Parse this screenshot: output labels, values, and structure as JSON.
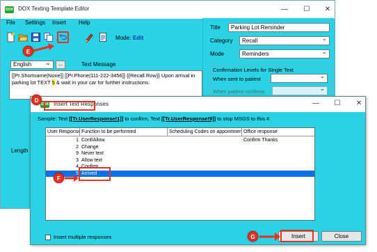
{
  "editor": {
    "title": "DOX Texting Template Editor",
    "logo": "DOX",
    "window_controls": [
      "—",
      "☐",
      "✕"
    ],
    "menu": [
      "File",
      "Settings",
      "Insert",
      "Help"
    ],
    "toolbar_icons": [
      "new-doc-icon",
      "open-folder-icon",
      "save-icon",
      "copy-icon",
      "undo-icon",
      "spellcheck-icon",
      "preview-icon"
    ],
    "mode_label": "Mode:",
    "mode_value": "Edit",
    "language": "English",
    "lang_button": "...",
    "text_message_label": "Text Message",
    "message_parts": [
      "[[Pr.Shortname|None]] [[Pr.Phone|111-222-3456]]  {{Recall Row}}  Upon arrival in parking lot TEXT ",
      "5",
      " & wait in your car for further instructions."
    ],
    "length_label": "Length is"
  },
  "right_panel": {
    "title_label": "Title",
    "title_value": "Parking Lot Reminder",
    "category_label": "Category",
    "category_value": "Recall",
    "mode_label": "Mode",
    "mode_value": "Reminders",
    "confirm_heading": "Confirmation Levels for Single Text",
    "sent_label": "When sent to patient",
    "confirms_label": "When patient confirms"
  },
  "dialog": {
    "title": "Insert Text Responses",
    "logo": "DOX",
    "window_controls": [
      "—",
      "☐",
      "✕"
    ],
    "sample_prefix": "Sample:  Text  ",
    "sample_token1": "[[Tr.UserResponse!1]]",
    "sample_mid": "  to confirm, Text  ",
    "sample_token2": "[[Tr.UserResponse!9]]",
    "sample_suffix": "  to stop MSGS to this #.",
    "columns": [
      "User Response",
      "Function to be performed",
      "Scheduling Codes on appointment",
      "Office response"
    ],
    "rows": [
      {
        "response": "1",
        "function": "Conf/Allow",
        "codes": "",
        "office": "Confirm Thanks"
      },
      {
        "response": "2",
        "function": "Change",
        "codes": "",
        "office": ""
      },
      {
        "response": "9",
        "function": "Never text",
        "codes": "",
        "office": ""
      },
      {
        "response": "3",
        "function": "Allow text",
        "codes": "",
        "office": ""
      },
      {
        "response": "4",
        "function": "Confirm",
        "codes": "",
        "office": ""
      },
      {
        "response": "5",
        "function": "Arrived",
        "codes": "",
        "office": ""
      }
    ],
    "selected_row": 5,
    "multi_label": "Insert multiple responses",
    "insert_label": "Insert",
    "close_label": "Close"
  },
  "annotations": [
    "E",
    "D",
    "F",
    "G"
  ],
  "colors": {
    "panel": "#29d2e4",
    "accent_red": "#e53222",
    "selection": "#0a72e6",
    "logo_green": "#27a12e"
  }
}
